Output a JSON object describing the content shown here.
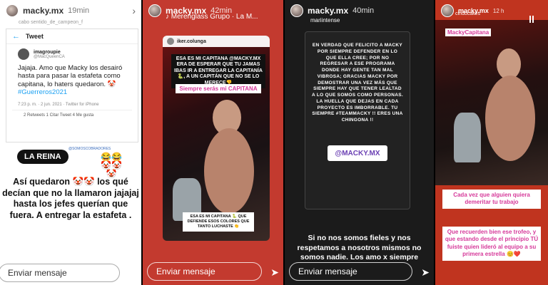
{
  "panel1": {
    "username": "macky.mx",
    "time": "19min",
    "subtitle": "cabo sentido_de_campeon_f",
    "tweet": {
      "header": "Tweet",
      "author": "imagroupie",
      "handle": "@MacQueenCA",
      "text": "Jajaja. Amo que Macky los desairó hasta para pasar la estafeta como capitana, lo haters quedaron.",
      "hashtag": "#Guerreros2021",
      "meta": "7:23 p. m. · 2 jun. 2021 · Twitter for iPhone",
      "stats": "2 Retweets   1 Citar Tweet   4 Me gusta"
    },
    "badge": "LA REINA",
    "badge_note": "@SOMOSCOBRADORES",
    "caption": "Así quedaron 🤡🤡 los qué decían que no la llamaron jajajaj hasta los jefes querían que fuera. A entregar la estafeta .",
    "reply_placeholder": "Enviar mensaje"
  },
  "panel2": {
    "username": "macky.mx",
    "time": "42min",
    "music": "♪ Merenglass Grupo · La M...",
    "repost_user": "iker.colunga",
    "caption_top": "ESA ES MI CAPITANA @MACKY.MX ERA DE ESPERAR QUE TU JAMAS IBAS IR A ENTREGAR LA CAPITANÍA 🐍, A UN CAPITÁN QUE NO SE LO MERECE👎",
    "caption_mid": "Siempre serás mi CAPITANA",
    "caption_bottom": "ESA ES MI CAPITANA 🐍 QUE DEFIENDE ESOS COLORES QUE TANTO LUCHASTE 👏",
    "reply_placeholder": "Enviar mensaje"
  },
  "panel3": {
    "username": "macky.mx",
    "time": "40min",
    "subtitle": "mariintense",
    "body": "EN VERDAD QUE FELICITO A MACKY POR SIEMPRE DEFENDER EN LO QUE ELLA CREE; POR NO REGRESAR A ESE PROGRAMA DONDE HAY GENTE TAN MAL VIBROSA; GRACIAS MACKY POR DEMOSTRAR UNA VEZ MÁS QUE SIEMPRE HAY QUE TENER LEALTAD A LO QUE SOMOS COMO PERSONAS. LA HUELLA QUE DEJAS EN CADA PROYECTO ES IMBORRABLE. TU SIEMPRE #TEAMMACKY !! ERES UNA CHINGONA !!",
    "mention": "@MACKY.MX",
    "bottom": "Si no nos somos fieles y nos respetamos a nosotros mismos no somos nadie. Los amo x siempre",
    "reply_placeholder": "Enviar mensaje"
  },
  "panel4": {
    "username": "macky.mx",
    "time": "12 h",
    "subtitle": "cindocakes",
    "tag": "MackyCapitana",
    "caption1": "Cada vez que alguien quiera demeritar tu trabajo",
    "caption2": "Que recuerden bien ese trofeo, y que estando desde el principio TÚ fuiste quien lideró al equipo a su primera estrella 😊❤️"
  }
}
